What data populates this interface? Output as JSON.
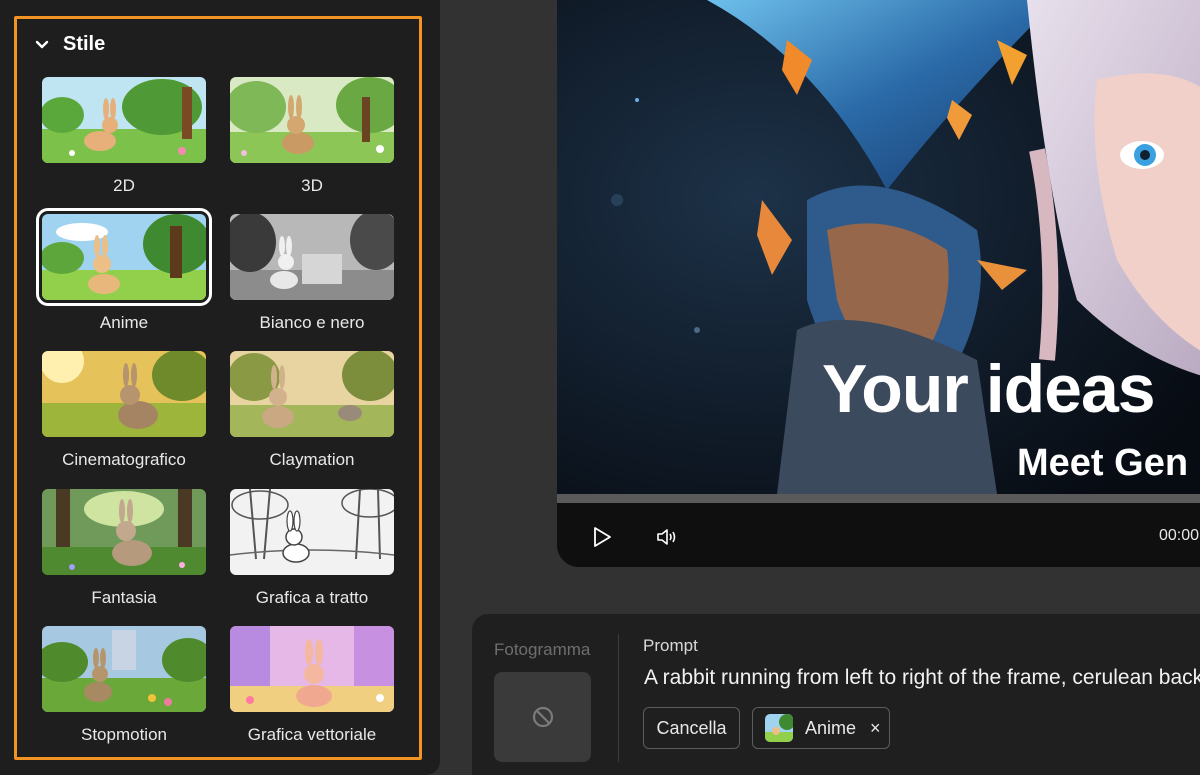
{
  "style_panel": {
    "title": "Stile",
    "tiles": [
      {
        "label": "2D"
      },
      {
        "label": "3D"
      },
      {
        "label": "Anime",
        "selected": true
      },
      {
        "label": "Bianco e nero"
      },
      {
        "label": "Cinematografico"
      },
      {
        "label": "Claymation"
      },
      {
        "label": "Fantasia"
      },
      {
        "label": "Grafica a tratto"
      },
      {
        "label": "Stopmotion"
      },
      {
        "label": "Grafica vettoriale"
      }
    ]
  },
  "video": {
    "headline": "Your ideas",
    "subheadline": "Meet Gen",
    "time": "00:00"
  },
  "prompt_panel": {
    "frame_label": "Fotogramma",
    "prompt_label": "Prompt",
    "prompt_text": "A rabbit running from left to right of the frame, cerulean backg",
    "cancel_label": "Cancella",
    "style_chip_label": "Anime",
    "remove_symbol": "×"
  },
  "colors": {
    "accent_outline": "#f29423",
    "panel_bg": "#1e1e1e",
    "page_bg": "#323232"
  }
}
